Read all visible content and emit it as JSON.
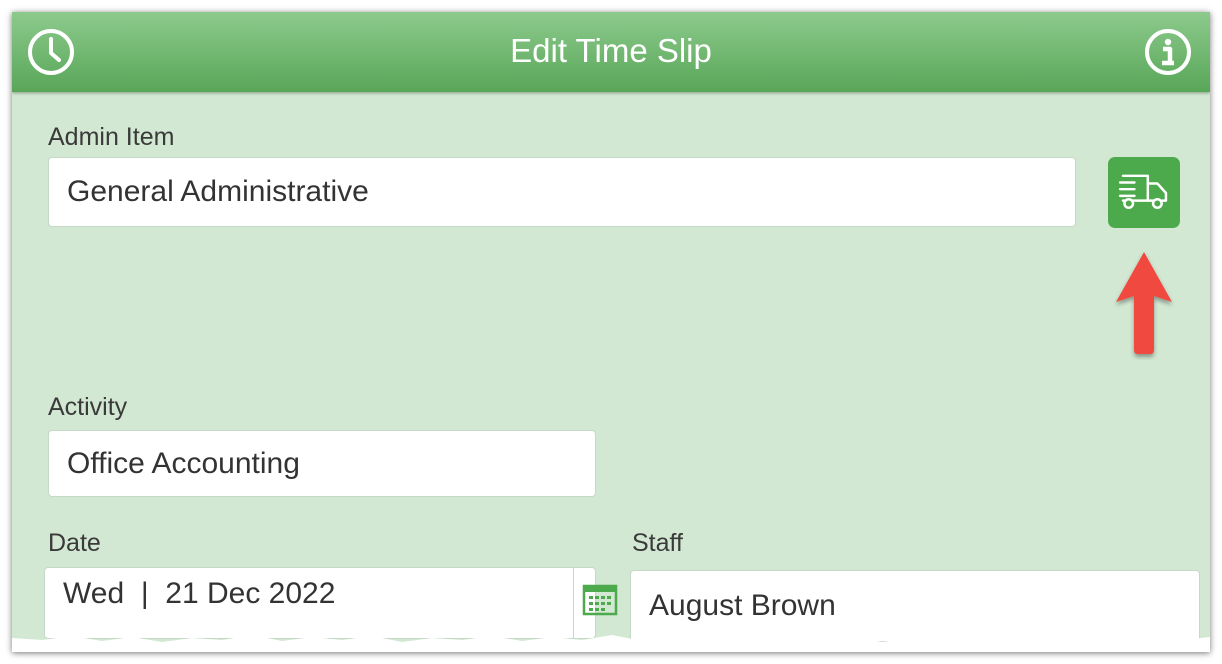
{
  "header": {
    "title": "Edit Time Slip",
    "left_icon": "clock-icon",
    "right_icon": "info-icon"
  },
  "admin_item": {
    "label": "Admin Item",
    "value": "General Administrative",
    "action_icon": "delivery-truck-icon"
  },
  "activity": {
    "label": "Activity",
    "value": "Office Accounting"
  },
  "date": {
    "label": "Date",
    "value": "Wed  |  21 Dec 2022",
    "icon": "calendar-icon"
  },
  "staff": {
    "label": "Staff",
    "value": "August Brown"
  },
  "colors": {
    "header_gradient_top": "#8dca8d",
    "header_gradient_bottom": "#58a658",
    "background": "#d2e8d2",
    "button": "#4caa4c",
    "arrow": "#f04a3f"
  }
}
